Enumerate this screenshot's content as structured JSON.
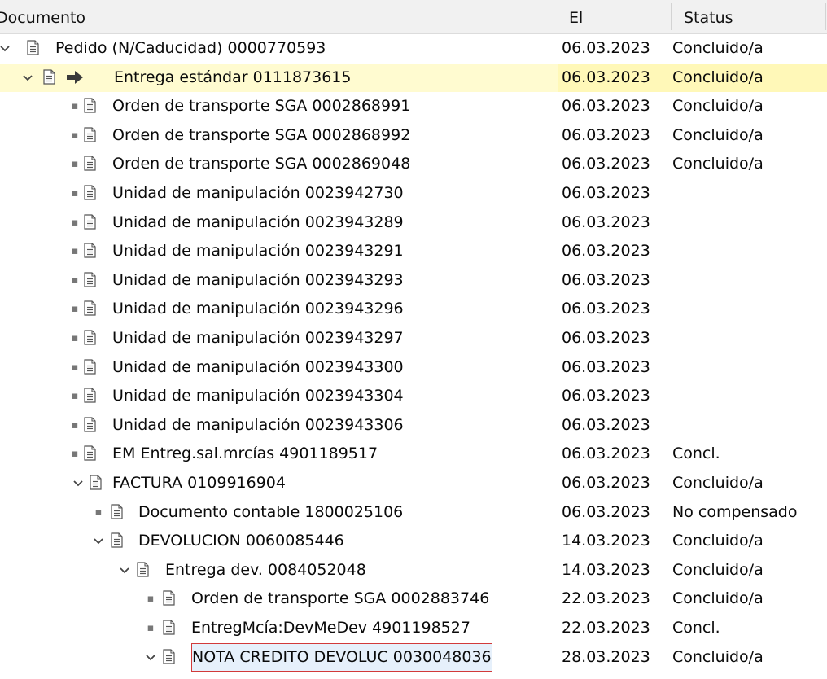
{
  "header": {
    "doc": "Documento",
    "el": "El",
    "status": "Status"
  },
  "rows": [
    {
      "label": "Pedido (N/Caducidad) 0000770593",
      "date": "06.03.2023",
      "status": "Concluido/a"
    },
    {
      "label": "Entrega estándar 0111873615",
      "date": "06.03.2023",
      "status": "Concluido/a"
    },
    {
      "label": "Orden de transporte SGA 0002868991",
      "date": "06.03.2023",
      "status": "Concluido/a"
    },
    {
      "label": "Orden de transporte SGA 0002868992",
      "date": "06.03.2023",
      "status": "Concluido/a"
    },
    {
      "label": "Orden de transporte SGA 0002869048",
      "date": "06.03.2023",
      "status": "Concluido/a"
    },
    {
      "label": "Unidad de manipulación 0023942730",
      "date": "06.03.2023",
      "status": ""
    },
    {
      "label": "Unidad de manipulación 0023943289",
      "date": "06.03.2023",
      "status": ""
    },
    {
      "label": "Unidad de manipulación 0023943291",
      "date": "06.03.2023",
      "status": ""
    },
    {
      "label": "Unidad de manipulación 0023943293",
      "date": "06.03.2023",
      "status": ""
    },
    {
      "label": "Unidad de manipulación 0023943296",
      "date": "06.03.2023",
      "status": ""
    },
    {
      "label": "Unidad de manipulación 0023943297",
      "date": "06.03.2023",
      "status": ""
    },
    {
      "label": "Unidad de manipulación 0023943300",
      "date": "06.03.2023",
      "status": ""
    },
    {
      "label": "Unidad de manipulación 0023943304",
      "date": "06.03.2023",
      "status": ""
    },
    {
      "label": "Unidad de manipulación 0023943306",
      "date": "06.03.2023",
      "status": ""
    },
    {
      "label": "EM Entreg.sal.mrcías 4901189517",
      "date": "06.03.2023",
      "status": "Concl."
    },
    {
      "label": "FACTURA 0109916904",
      "date": "06.03.2023",
      "status": "Concluido/a"
    },
    {
      "label": "Documento contable 1800025106",
      "date": "06.03.2023",
      "status": "No compensado"
    },
    {
      "label": "DEVOLUCION 0060085446",
      "date": "14.03.2023",
      "status": "Concluido/a"
    },
    {
      "label": "Entrega dev. 0084052048",
      "date": "14.03.2023",
      "status": "Concluido/a"
    },
    {
      "label": "Orden de transporte SGA 0002883746",
      "date": "22.03.2023",
      "status": "Concluido/a"
    },
    {
      "label": "EntregMcía:DevMeDev 4901198527",
      "date": "22.03.2023",
      "status": "Concl."
    },
    {
      "label": "NOTA CREDITO DEVOLUC 0030048036",
      "date": "28.03.2023",
      "status": "Concluido/a"
    }
  ]
}
